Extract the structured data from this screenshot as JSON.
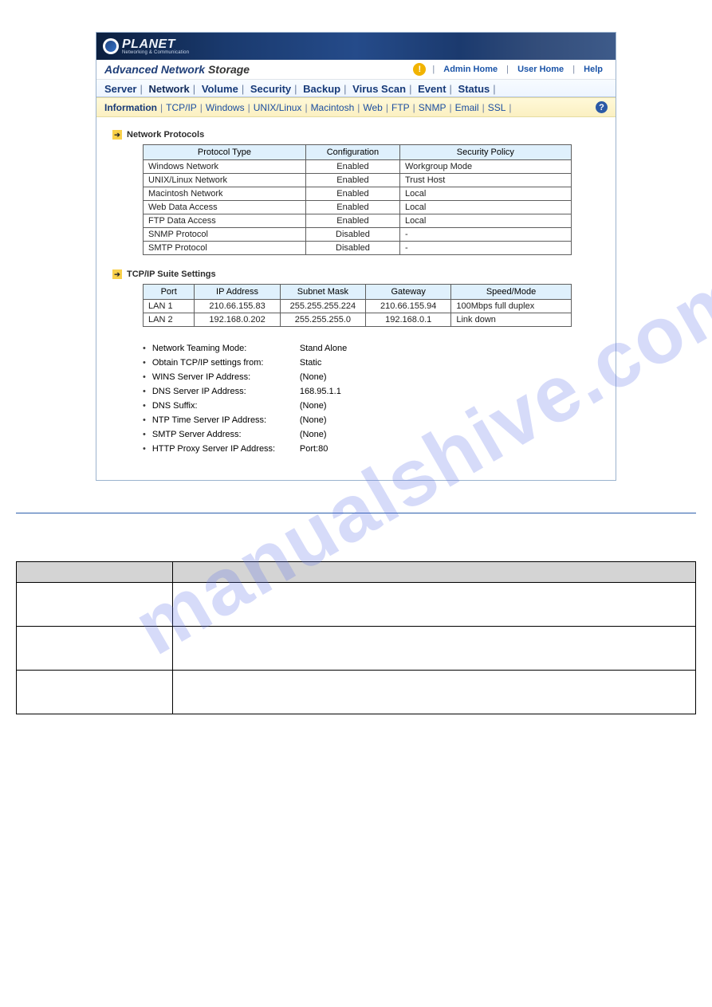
{
  "brand": {
    "name": "PLANET",
    "subtitle": "Networking & Communication"
  },
  "title": {
    "advanced": "Advanced ",
    "network": "Network ",
    "storage": "Storage"
  },
  "top_links": {
    "admin": "Admin Home",
    "user": "User Home",
    "help": "Help"
  },
  "primary_tabs": [
    "Server",
    "Network",
    "Volume",
    "Security",
    "Backup",
    "Virus Scan",
    "Event",
    "Status"
  ],
  "primary_active": "Network",
  "secondary_tabs": [
    "Information",
    "TCP/IP",
    "Windows",
    "UNIX/Linux",
    "Macintosh",
    "Web",
    "FTP",
    "SNMP",
    "Email",
    "SSL"
  ],
  "secondary_active": "Information",
  "sections": {
    "protocols_title": "Network Protocols",
    "tcpip_title": "TCP/IP Suite Settings"
  },
  "protocols": {
    "headers": [
      "Protocol Type",
      "Configuration",
      "Security Policy"
    ],
    "rows": [
      [
        "Windows Network",
        "Enabled",
        "Workgroup Mode"
      ],
      [
        "UNIX/Linux Network",
        "Enabled",
        "Trust Host"
      ],
      [
        "Macintosh Network",
        "Enabled",
        "Local"
      ],
      [
        "Web Data Access",
        "Enabled",
        "Local"
      ],
      [
        "FTP Data Access",
        "Enabled",
        "Local"
      ],
      [
        "SNMP Protocol",
        "Disabled",
        "-"
      ],
      [
        "SMTP Protocol",
        "Disabled",
        "-"
      ]
    ]
  },
  "tcpip": {
    "headers": [
      "Port",
      "IP Address",
      "Subnet Mask",
      "Gateway",
      "Speed/Mode"
    ],
    "rows": [
      [
        "LAN 1",
        "210.66.155.83",
        "255.255.255.224",
        "210.66.155.94",
        "100Mbps full duplex"
      ],
      [
        "LAN 2",
        "192.168.0.202",
        "255.255.255.0",
        "192.168.0.1",
        "Link down"
      ]
    ]
  },
  "settings_list": [
    {
      "label": "Network Teaming Mode:",
      "value": "Stand Alone"
    },
    {
      "label": "Obtain TCP/IP settings from:",
      "value": "Static"
    },
    {
      "label": "WINS Server IP Address:",
      "value": "(None)"
    },
    {
      "label": "DNS Server IP Address:",
      "value": "168.95.1.1"
    },
    {
      "label": "DNS Suffix:",
      "value": "(None)"
    },
    {
      "label": "NTP Time Server IP Address:",
      "value": "(None)"
    },
    {
      "label": "SMTP Server Address:",
      "value": "(None)"
    },
    {
      "label": "HTTP Proxy Server IP Address:",
      "value": "Port:80"
    }
  ],
  "watermark": "manualshive.com"
}
